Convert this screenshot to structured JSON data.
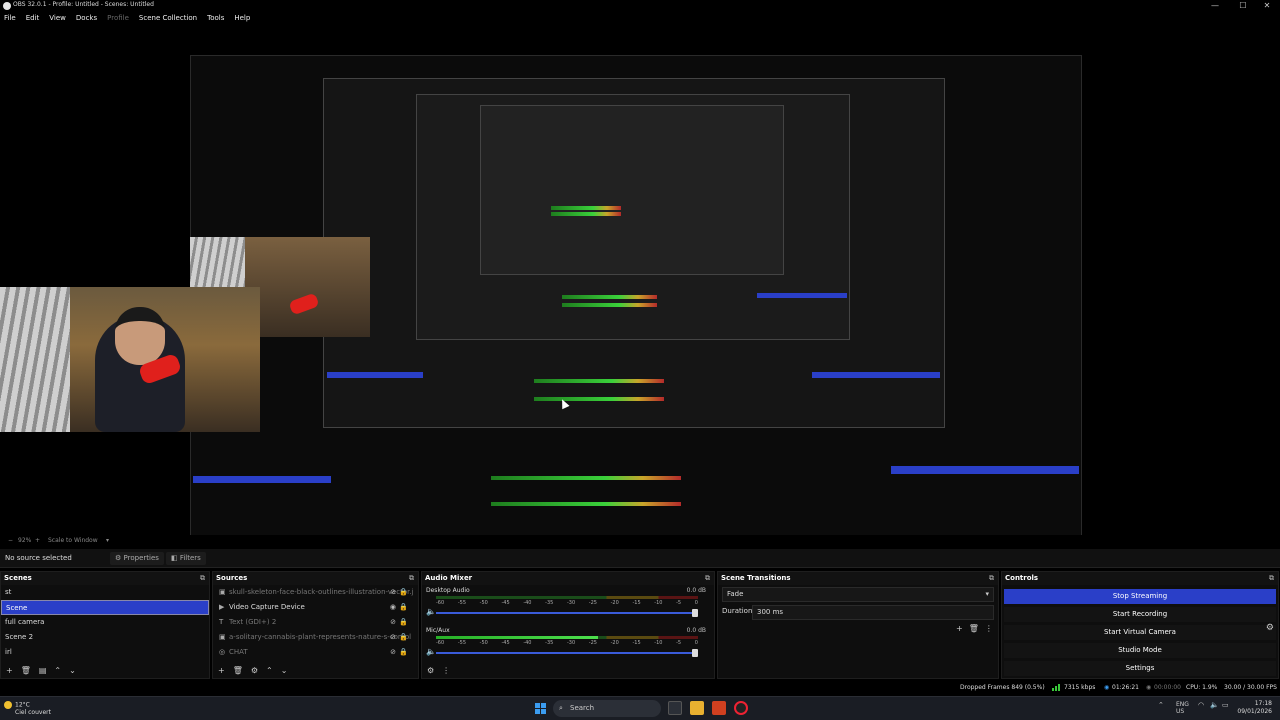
{
  "window": {
    "title": "OBS 32.0.1 - Profile: Untitled - Scenes: Untitled",
    "min": "—",
    "max": "☐",
    "close": "✕"
  },
  "menu": [
    "File",
    "Edit",
    "View",
    "Docks",
    "Profile",
    "Scene Collection",
    "Tools",
    "Help"
  ],
  "zoom": {
    "level": "92%",
    "mode": "Scale to Window"
  },
  "source_toolbar": {
    "no_source": "No source selected",
    "properties": "Properties",
    "filters": "Filters"
  },
  "scenes": {
    "title": "Scenes",
    "items": [
      "st",
      "Scene",
      "full camera",
      "Scene 2",
      "irl"
    ],
    "active_index": 1
  },
  "sources": {
    "title": "Sources",
    "items": [
      {
        "name": "skull-skeleton-face-black-outlines-illustration-vector.j",
        "dim": true
      },
      {
        "name": "Video Capture Device",
        "dim": false
      },
      {
        "name": "Text (GDI+) 2",
        "dim": true
      },
      {
        "name": "a-solitary-cannabis-plant-represents-nature-s-compl",
        "dim": true
      },
      {
        "name": "CHAT",
        "dim": true
      }
    ]
  },
  "mixer": {
    "title": "Audio Mixer",
    "channels": [
      {
        "name": "Desktop Audio",
        "db": "0.0 dB",
        "level": 0.0
      },
      {
        "name": "Mic/Aux",
        "db": "0.0 dB",
        "level": 0.62
      }
    ],
    "ticks": [
      "-60",
      "-55",
      "-50",
      "-45",
      "-40",
      "-35",
      "-30",
      "-25",
      "-20",
      "-15",
      "-10",
      "-5",
      "0"
    ]
  },
  "transitions": {
    "title": "Scene Transitions",
    "selected": "Fade",
    "duration_label": "Duration",
    "duration_value": "300 ms"
  },
  "controls": {
    "title": "Controls",
    "buttons": [
      "Stop Streaming",
      "Start Recording",
      "Start Virtual Camera",
      "Studio Mode",
      "Settings"
    ]
  },
  "status": {
    "dropped": "Dropped Frames 849 (0.5%)",
    "bitrate": "7315 kbps",
    "stream_time": "01:26:21",
    "rec_time": "00:00:00",
    "cpu": "CPU: 1.9%",
    "fps": "30.00 / 30.00 FPS"
  },
  "taskbar": {
    "temp": "12°C",
    "weather": "Ciel couvert",
    "search": "Search",
    "lang": "ENG",
    "region": "US",
    "time": "17:18",
    "date": "09/01/2026"
  },
  "colors": {
    "accent": "#2a3fc8",
    "meter_green": "#3ad13a",
    "meter_yellow": "#c9a52a",
    "meter_red": "#b42a2a"
  }
}
